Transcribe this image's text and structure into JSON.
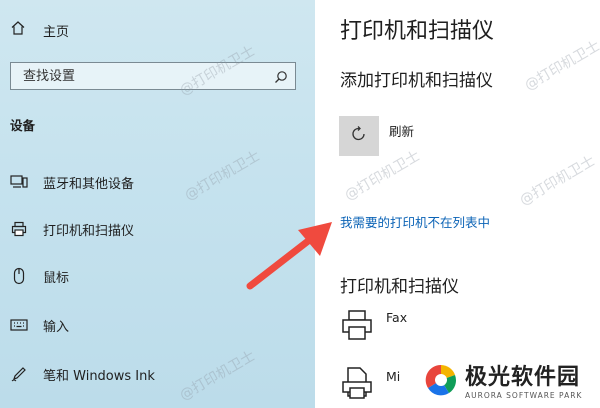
{
  "sidebar": {
    "home_label": "主页",
    "search_placeholder": "查找设置",
    "section_title": "设备",
    "items": [
      {
        "label": "蓝牙和其他设备",
        "icon": "bluetooth-devices-icon"
      },
      {
        "label": "打印机和扫描仪",
        "icon": "printer-icon"
      },
      {
        "label": "鼠标",
        "icon": "mouse-icon"
      },
      {
        "label": "输入",
        "icon": "keyboard-icon"
      },
      {
        "label": "笔和 Windows Ink",
        "icon": "pen-icon"
      }
    ]
  },
  "main": {
    "title": "打印机和扫描仪",
    "add_section_title": "添加打印机和扫描仪",
    "refresh_label": "刷新",
    "not_listed_link": "我需要的打印机不在列表中",
    "printers_section_title": "打印机和扫描仪",
    "devices": [
      {
        "name": "Fax",
        "icon": "fax-printer-icon"
      },
      {
        "name": "Mi",
        "icon": "document-printer-icon"
      }
    ]
  },
  "watermark": "@打印机卫士",
  "logo": {
    "name": "极光软件园",
    "subtitle": "AURORA SOFTWARE PARK"
  },
  "colors": {
    "link": "#0b63b6",
    "arrow": "#f04a3e",
    "sidebar_bg": "#c5e2ee"
  }
}
